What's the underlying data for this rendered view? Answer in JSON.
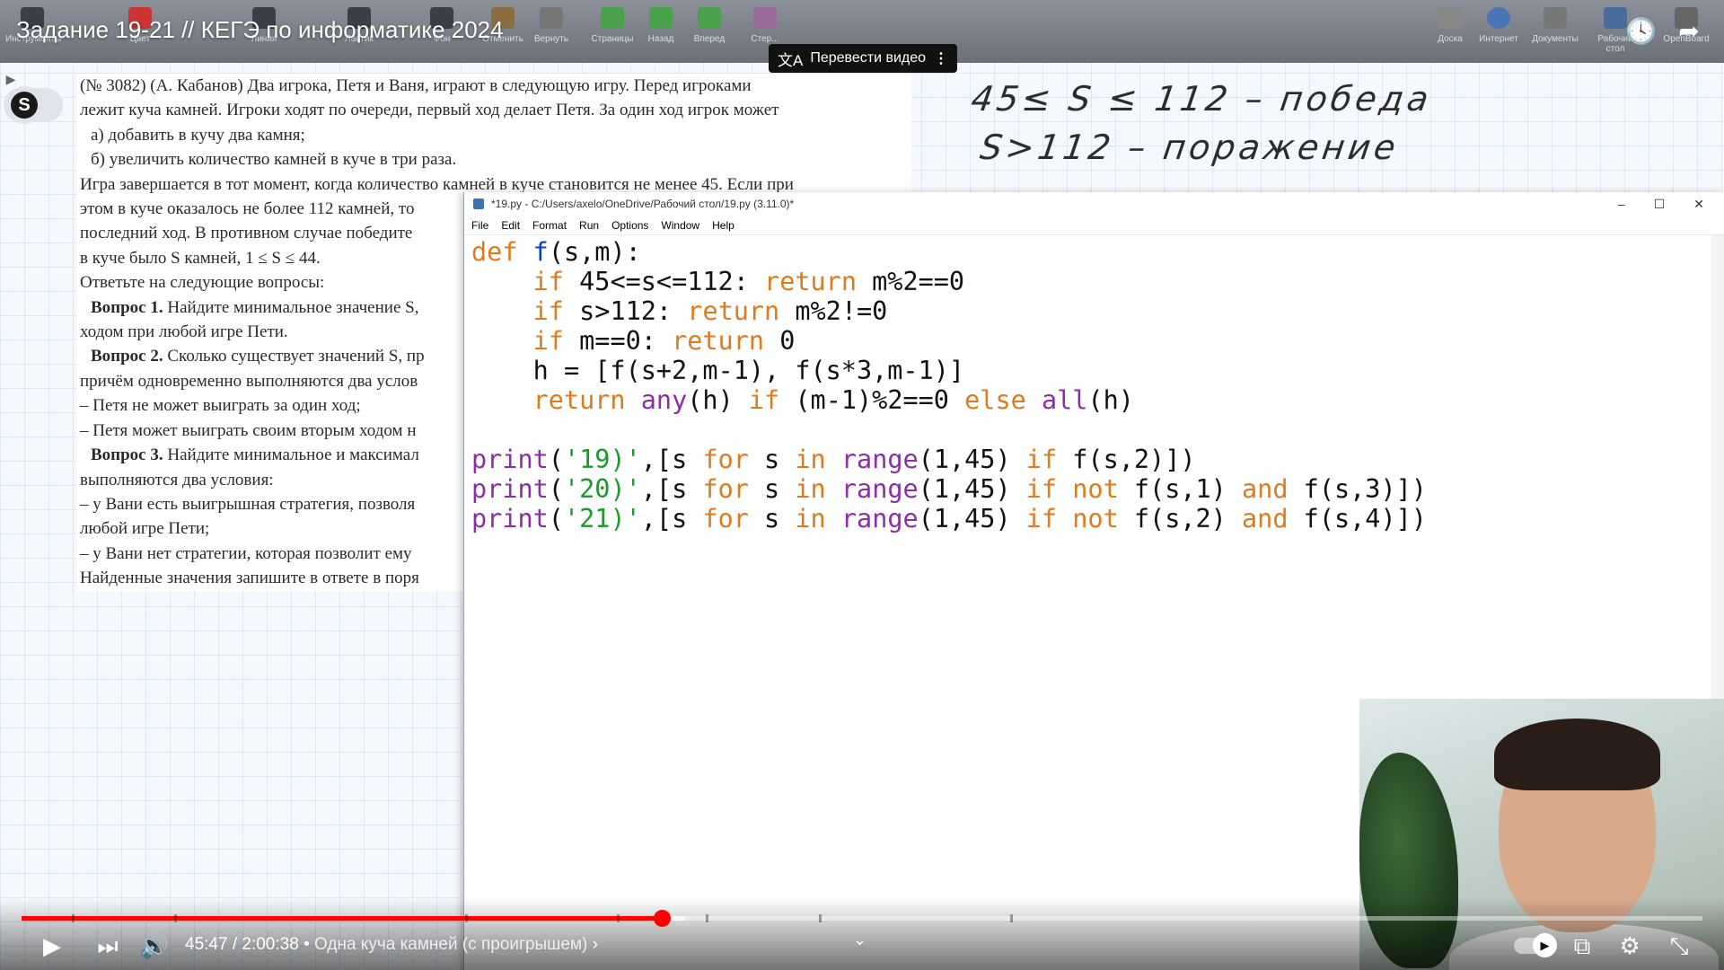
{
  "video": {
    "title": "Задание 19-21 // КЕГЭ по информатике 2024",
    "translate_label": "Перевести видео",
    "time_current": "45:47",
    "time_total": "2:00:38",
    "chapter": "Одна куча камней (с проигрышем)",
    "progress_fraction": 0.381
  },
  "toolbar": {
    "tools": [
      "Инструменты",
      "Цвет",
      "Линия",
      "Ластик",
      "Фон",
      "Отменить",
      "Вернуть",
      "Страницы",
      "Назад",
      "Вперед",
      "Стер..."
    ],
    "right_tools": [
      "Доска",
      "Интернет",
      "Документы",
      "Рабочий стол",
      "OpenBoard"
    ]
  },
  "task": {
    "lines": [
      "(№ 3082) (А. Кабанов) Два игрока, Петя и Ваня, играют в следующую игру. Перед игроками",
      "лежит куча камней. Игроки ходят по очереди, первый ход делает Петя. За один ход игрок может",
      "а) добавить в кучу два камня;",
      "б) увеличить количество камней в куче в три раза.",
      "Игра завершается в тот момент, когда количество камней в куче становится не менее 45. Если при",
      "этом в куче оказалось не более 112 камней, то",
      "последний ход. В противном случае победите",
      "в куче было S камней, 1 ≤ S ≤ 44.",
      "Ответьте на следующие вопросы:",
      "Найдите минимальное значение S,",
      "ходом при любой игре Пети.",
      "Сколько существует значений S, пр",
      "причём одновременно выполняются два услов",
      "– Петя не может выиграть за один ход;",
      "– Петя может выиграть своим вторым ходом н",
      "Найдите минимальное и максимал",
      "выполняются два условия:",
      "– у Вани есть выигрышная стратегия, позволя",
      "любой игре Пети;",
      "– у Вани нет стратегии, которая позволит ему",
      "Найденные значения запишите в ответе в поря"
    ],
    "q1": "Вопрос 1.",
    "q2": "Вопрос 2.",
    "q3": "Вопрос 3."
  },
  "handwriting": {
    "line1": "45≤ S ≤ 112 – победа",
    "line2": "S>112 – поражение"
  },
  "idle": {
    "title": "*19.py - C:/Users/axelo/OneDrive/Рабочий стол/19.py (3.11.0)*",
    "menu": [
      "File",
      "Edit",
      "Format",
      "Run",
      "Options",
      "Window",
      "Help"
    ]
  },
  "colors": {
    "keyword": "#e07a1f",
    "function": "#0d3bd6",
    "builtin": "#8b2ea8",
    "string": "#1b9a2c",
    "progress": "#ff0000"
  }
}
